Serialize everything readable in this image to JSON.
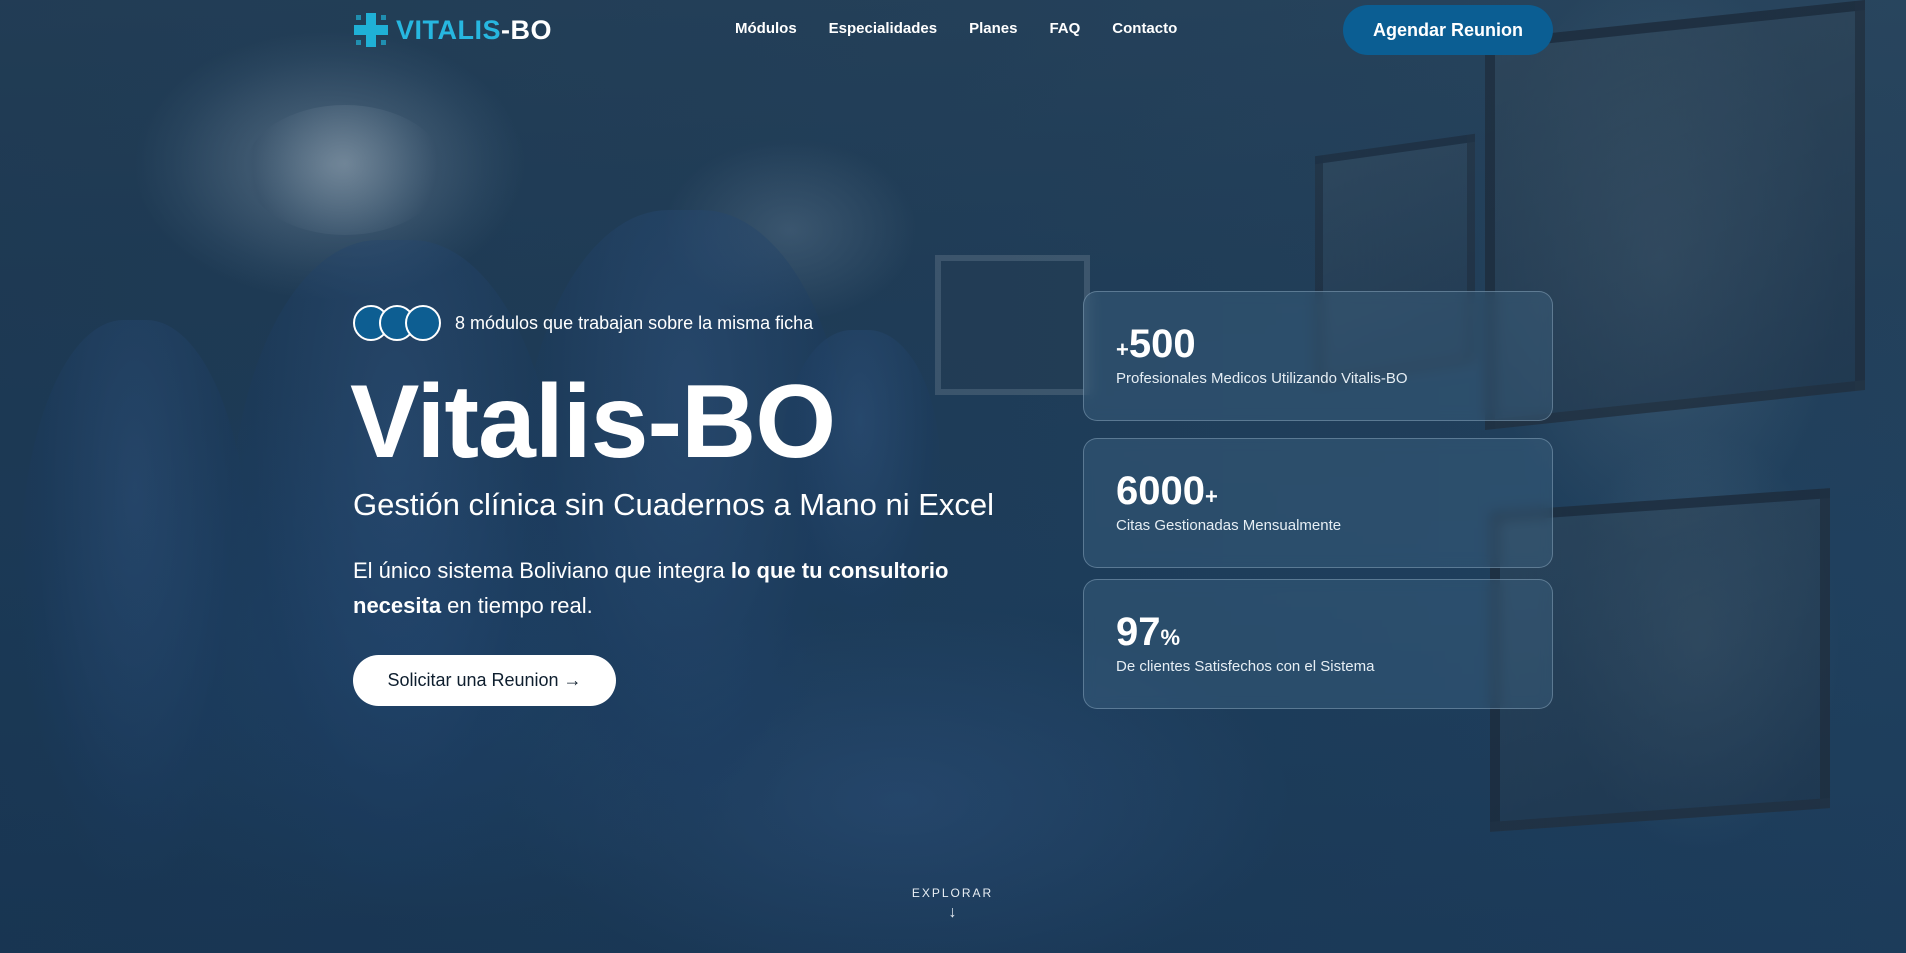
{
  "brand": {
    "logo_part1": "VITALIS",
    "logo_part2": "-BO",
    "accent_color": "#27b7e0",
    "button_color": "#0b5e93"
  },
  "nav": {
    "items": [
      {
        "label": "Módulos"
      },
      {
        "label": "Especialidades"
      },
      {
        "label": "Planes"
      },
      {
        "label": "FAQ"
      },
      {
        "label": "Contacto"
      }
    ],
    "cta_label": "Agendar Reunion"
  },
  "hero": {
    "badge_text": "8 módulos que trabajan sobre la misma ficha",
    "title": "Vitalis-BO",
    "subtitle": "Gestión clínica sin Cuadernos a Mano ni Excel",
    "desc_part1": "El único sistema Boliviano que integra ",
    "desc_bold1": "lo que tu consultorio",
    "desc_bold2": "necesita",
    "desc_part2": " en tiempo real.",
    "cta_label": "Solicitar una Reunion →"
  },
  "stats": [
    {
      "prefix": "+",
      "value": "500",
      "suffix": "",
      "label": "Profesionales Medicos Utilizando Vitalis-BO"
    },
    {
      "prefix": "",
      "value": "6000",
      "suffix": "+",
      "label": "Citas Gestionadas Mensualmente"
    },
    {
      "prefix": "",
      "value": "97",
      "suffix": "%",
      "label": "De clientes Satisfechos con el Sistema"
    }
  ],
  "explore": {
    "label": "EXPLORAR",
    "arrow_icon": "arrow-down-icon"
  }
}
